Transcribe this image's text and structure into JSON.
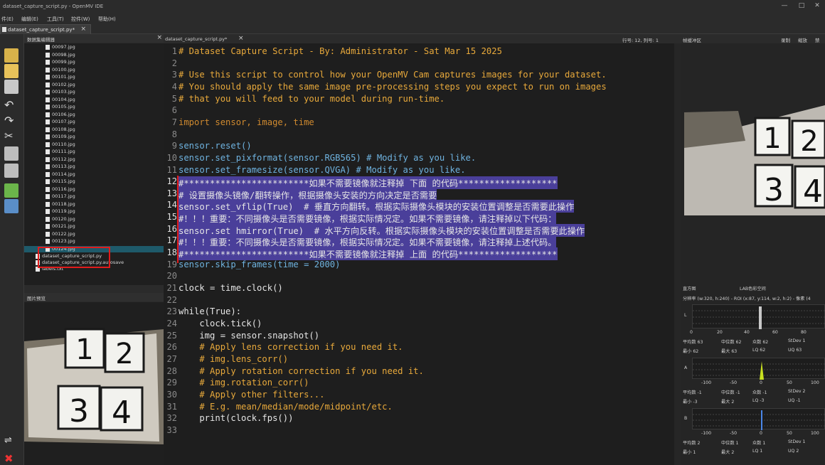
{
  "window": {
    "title": "dataset_capture_script.py - OpenMV IDE"
  },
  "menu": [
    "件(E)",
    "编辑(E)",
    "工具(T)",
    "控件(W)",
    "帮助(H)"
  ],
  "tab": {
    "label": "dataset_capture_script.py*",
    "close": "×"
  },
  "file_panel": {
    "title": "数据集编辑器",
    "files": [
      "00097.jpg",
      "00098.jpg",
      "00099.jpg",
      "00100.jpg",
      "00101.jpg",
      "00102.jpg",
      "00103.jpg",
      "00104.jpg",
      "00105.jpg",
      "00106.jpg",
      "00107.jpg",
      "00108.jpg",
      "00109.jpg",
      "00110.jpg",
      "00111.jpg",
      "00112.jpg",
      "00113.jpg",
      "00114.jpg",
      "00115.jpg",
      "00116.jpg",
      "00117.jpg",
      "00118.jpg",
      "00119.jpg",
      "00120.jpg",
      "00121.jpg",
      "00122.jpg",
      "00123.jpg",
      "00124.jpg"
    ],
    "selected_index": 27,
    "other_files": [
      "dataset_capture_script.py",
      "dataset_capture_script.py.autosave",
      "labels.txt"
    ]
  },
  "preview_panel": {
    "title": "图片预览",
    "digits": [
      "1",
      "2",
      "3",
      "4"
    ]
  },
  "editor": {
    "filename": "dataset_capture_script.py*",
    "close": "×",
    "position": "行号: 12, 列号: 1",
    "lines": [
      {
        "n": "1",
        "t": "# Dataset Capture Script - By: Administrator - Sat Mar 15 2025",
        "c": "c-com"
      },
      {
        "n": "2",
        "t": "",
        "c": "c-plain"
      },
      {
        "n": "3",
        "t": "# Use this script to control how your OpenMV Cam captures images for your dataset.",
        "c": "c-com"
      },
      {
        "n": "4",
        "t": "# You should apply the same image pre-processing steps you expect to run on images",
        "c": "c-com"
      },
      {
        "n": "5",
        "t": "# that you will feed to your model during run-time.",
        "c": "c-com"
      },
      {
        "n": "6",
        "t": "",
        "c": "c-plain"
      },
      {
        "n": "7",
        "t": "import sensor, image, time",
        "c": "c-kw"
      },
      {
        "n": "8",
        "t": "",
        "c": "c-plain"
      },
      {
        "n": "9",
        "t": "sensor.reset()",
        "c": "c-fn"
      },
      {
        "n": "10",
        "t": "sensor.set_pixformat(sensor.RGB565) # Modify as you like.",
        "c": "c-fn"
      },
      {
        "n": "11",
        "t": "sensor.set_framesize(sensor.QVGA) # Modify as you like.",
        "c": "c-fn"
      },
      {
        "n": "12",
        "t": "#************************如果不需要镜像就注释掉 下面 的代码*******************",
        "c": "c-plain",
        "hl": true
      },
      {
        "n": "13",
        "t": "# 设置摄像头镜像/翻转操作，根据摄像头安装的方向决定是否需要",
        "c": "c-plain",
        "hl": true
      },
      {
        "n": "14",
        "t": "sensor.set_vflip(True)  # 垂直方向翻转。根据实际摄像头模块的安装位置调整是否需要此操作",
        "c": "c-plain",
        "hl": true
      },
      {
        "n": "15",
        "t": "#！！！重要：不同摄像头是否需要镜像，根据实际情况定。如果不需要镜像，请注释掉以下代码：",
        "c": "c-plain",
        "hl": true
      },
      {
        "n": "16",
        "t": "sensor.set_hmirror(True)  # 水平方向反转。根据实际摄像头模块的安装位置调整是否需要此操作",
        "c": "c-plain",
        "hl": true
      },
      {
        "n": "17",
        "t": "#！！！重要：不同摄像头是否需要镜像，根据实际情况定。如果不需要镜像，请注释掉上述代码。",
        "c": "c-plain",
        "hl": true
      },
      {
        "n": "18",
        "t": "#************************如果不需要镜像就注释掉 上面 的代码*******************",
        "c": "c-plain",
        "hl": true
      },
      {
        "n": "19",
        "t": "sensor.skip_frames(time = 2000)",
        "c": "c-fn"
      },
      {
        "n": "20",
        "t": "",
        "c": "c-plain"
      },
      {
        "n": "21",
        "t": "clock = time.clock()",
        "c": "c-plain"
      },
      {
        "n": "22",
        "t": "",
        "c": "c-plain"
      },
      {
        "n": "23",
        "t": "while(True):",
        "c": "c-plain"
      },
      {
        "n": "24",
        "t": "    clock.tick()",
        "c": "c-plain"
      },
      {
        "n": "25",
        "t": "    img = sensor.snapshot()",
        "c": "c-plain"
      },
      {
        "n": "26",
        "t": "    # Apply lens correction if you need it.",
        "c": "c-com"
      },
      {
        "n": "27",
        "t": "    # img.lens_corr()",
        "c": "c-com"
      },
      {
        "n": "28",
        "t": "    # Apply rotation correction if you need it.",
        "c": "c-com"
      },
      {
        "n": "29",
        "t": "    # img.rotation_corr()",
        "c": "c-com"
      },
      {
        "n": "30",
        "t": "    # Apply other filters...",
        "c": "c-com"
      },
      {
        "n": "31",
        "t": "    # E.g. mean/median/mode/midpoint/etc.",
        "c": "c-com"
      },
      {
        "n": "32",
        "t": "    print(clock.fps())",
        "c": "c-plain"
      },
      {
        "n": "33",
        "t": "",
        "c": "c-plain"
      }
    ]
  },
  "framebuffer": {
    "title": "帧缓冲区",
    "record": "录制",
    "zoom": "缩放",
    "disable": "禁",
    "digits": [
      "1",
      "2",
      "3",
      "4"
    ]
  },
  "histogram": {
    "title": "直方图",
    "colorspace": "LAB色彩空间",
    "resolution": "分辨率 (w:320, h:240) - ROI (x:87, y:114, w:2, h:2) - 像素 (4",
    "ticks1": [
      "0",
      "20",
      "40",
      "60",
      "80"
    ],
    "stats1a": [
      "平均数 63",
      "中位数 62",
      "众数 62",
      "StDev 1"
    ],
    "stats1b": [
      "最小  62",
      "最大  63",
      "LQ  62",
      "UQ  63"
    ],
    "ticks2": [
      "-100",
      "-50",
      "0",
      "50",
      "100"
    ],
    "stats2a": [
      "平均数 -1",
      "中位数 -1",
      "众数 -1",
      "StDev 2"
    ],
    "stats2b": [
      "最小  -3",
      "最大  2",
      "LQ  -3",
      "UQ  -1"
    ],
    "ticks3": [
      "-100",
      "-50",
      "0",
      "50",
      "100"
    ],
    "stats3a": [
      "平均数 2",
      "中位数 1",
      "众数 1",
      "StDev 1"
    ],
    "stats3b": [
      "最小  1",
      "最大  2",
      "LQ  1",
      "UQ  2"
    ],
    "channel_labels": [
      "L",
      "A",
      "B"
    ]
  }
}
